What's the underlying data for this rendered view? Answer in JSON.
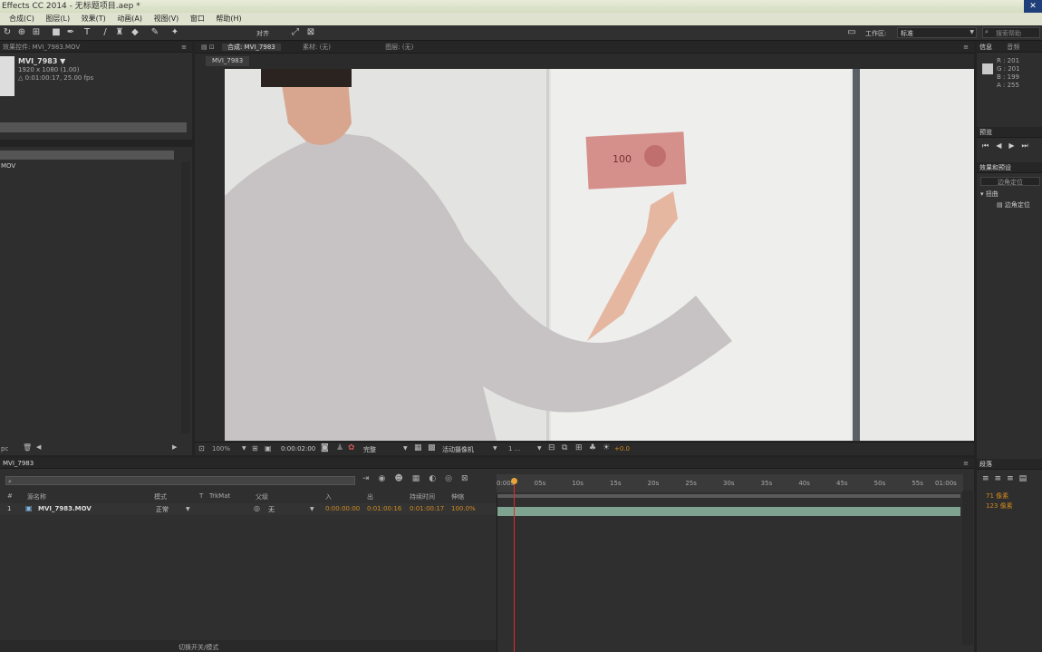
{
  "window": {
    "title": "Effects CC 2014 - 无标题项目.aep *",
    "close": "✕"
  },
  "menu": [
    "合成(C)",
    "图层(L)",
    "效果(T)",
    "动画(A)",
    "视图(V)",
    "窗口",
    "帮助(H)"
  ],
  "toolbar": {
    "align_label": "对齐",
    "workspace_label": "工作区:",
    "workspace_value": "标准",
    "search_placeholder": "搜索帮助"
  },
  "effects_panel": {
    "tab": "效果控件: MVI_7983.MOV",
    "name": "MVI_7983 ▼",
    "dims": "1920 x 1080 (1.00)",
    "duration": "△ 0:01:00:17, 25.00 fps",
    "item": "MOV",
    "bpc": "pc"
  },
  "viewer": {
    "tabs": [
      "合成: MVI_7983",
      "素材: (无)",
      "图层: (无)"
    ],
    "comp_name": "MVI_7983",
    "zoom": "100%",
    "timecode": "0:00:02:00",
    "quality": "完整",
    "camera": "活动摄像机",
    "views": "1 ...",
    "exposure": "+0.0"
  },
  "info_panel": {
    "tabs": [
      "信息",
      "音频"
    ],
    "r": "R : 201",
    "g": "G : 201",
    "b": "B : 199",
    "a": "A : 255"
  },
  "preview_panel": {
    "tab": "预览"
  },
  "effects_presets": {
    "tab": "效果和预设",
    "search": "边角定位",
    "category": "扭曲",
    "effect": "边角定位"
  },
  "paragraph_panel": {
    "tab": "段落",
    "indent1": "71 像素",
    "indent2": "123 像素"
  },
  "timeline": {
    "tab": "MVI_7983",
    "columns": {
      "source": "源名称",
      "mode": "模式",
      "t": "T",
      "trkmat": "TrkMat",
      "parent": "父级",
      "in": "入",
      "out": "出",
      "duration": "持续时间",
      "stretch": "伸缩"
    },
    "layer": {
      "index": "1",
      "name": "MVI_7983.MOV",
      "mode": "正常",
      "parent": "无",
      "in": "0:00:00:00",
      "out": "0:01:00:16",
      "duration": "0:01:00:17",
      "stretch": "100.0%"
    },
    "ruler": [
      "0:00s",
      "05s",
      "10s",
      "15s",
      "20s",
      "25s",
      "30s",
      "35s",
      "40s",
      "45s",
      "50s",
      "55s",
      "01:00s"
    ],
    "footer": "切换开关/模式"
  }
}
